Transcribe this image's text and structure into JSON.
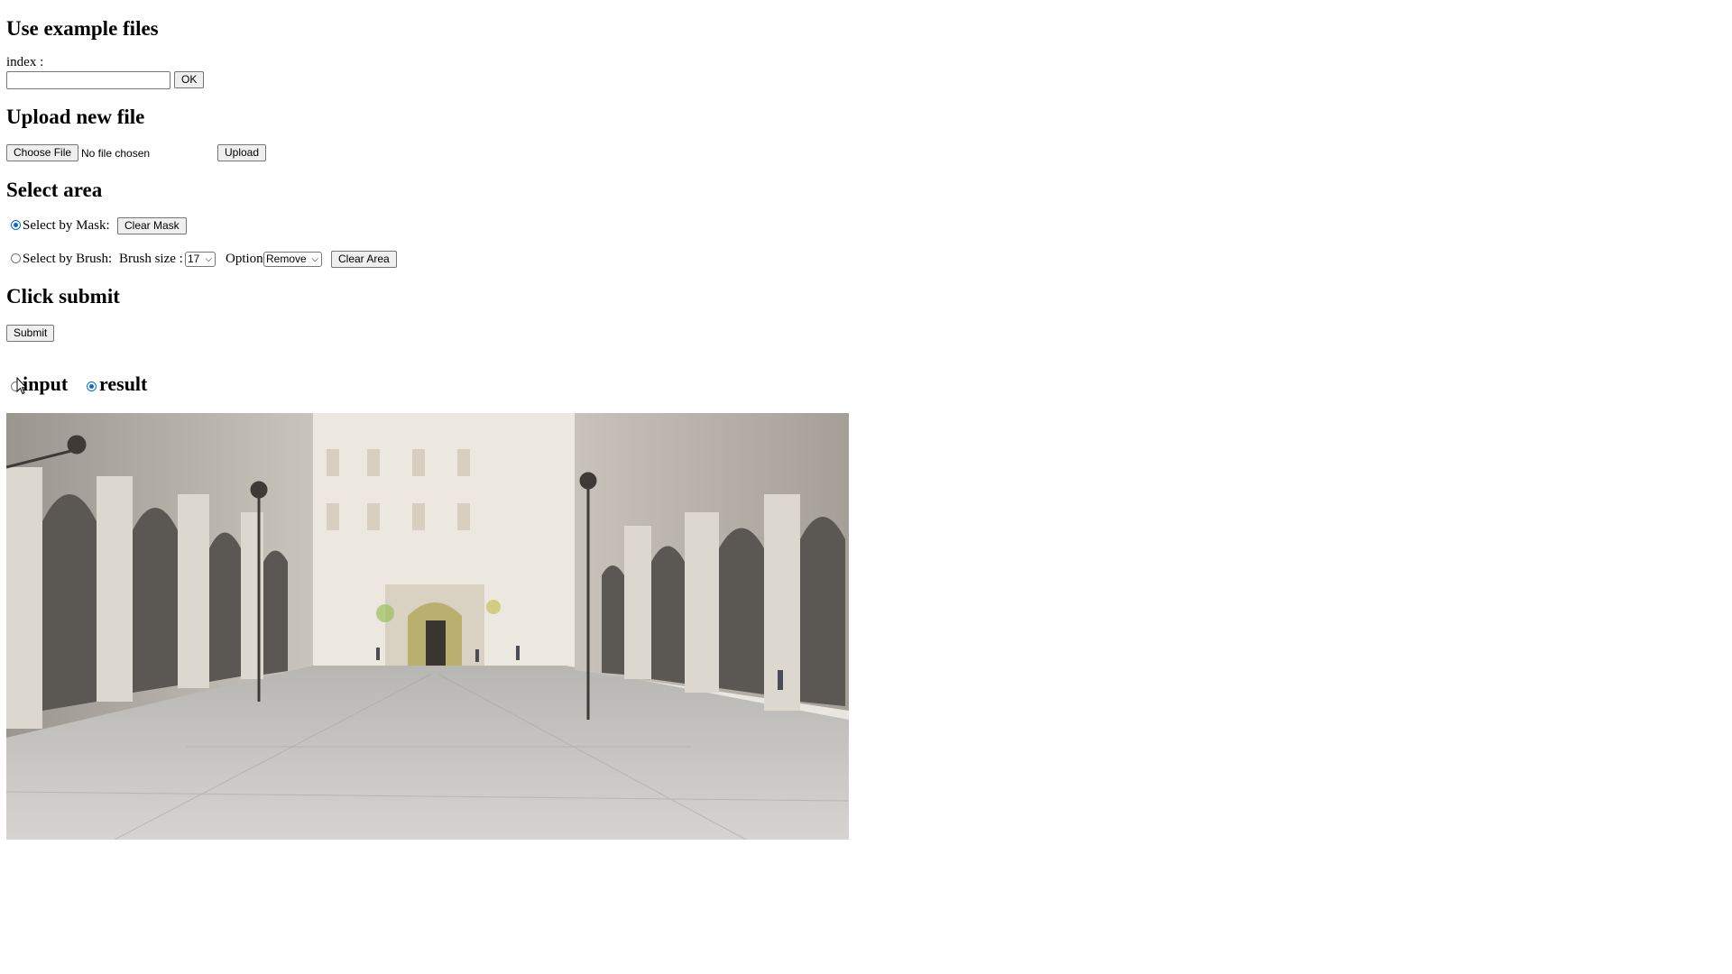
{
  "sections": {
    "example": {
      "heading": "Use example files",
      "index_label": "index :",
      "index_value": "",
      "ok_label": "OK"
    },
    "upload": {
      "heading": "Upload new file",
      "choose_label": "Choose File",
      "no_file_text": "No file chosen",
      "upload_label": "Upload"
    },
    "select_area": {
      "heading": "Select area",
      "mask_label": "Select by Mask:",
      "clear_mask_label": "Clear Mask",
      "brush_label": "Select by Brush:",
      "brush_size_label": "Brush size :",
      "brush_size_value": "17",
      "option_label": "Option",
      "option_value": "Remove",
      "clear_area_label": "Clear Area",
      "selected_mode": "mask"
    },
    "submit": {
      "heading": "Click submit",
      "submit_label": "Submit"
    }
  },
  "view_toggle": {
    "input_label": "input",
    "result_label": "result",
    "selected": "result"
  },
  "colors": {
    "radio_accent": "#0b68d6",
    "button_bg": "#efefef",
    "button_border": "#767676"
  },
  "icons": {
    "cursor": "arrow-cursor-icon",
    "select_chevron": "chevron-down-icon"
  }
}
